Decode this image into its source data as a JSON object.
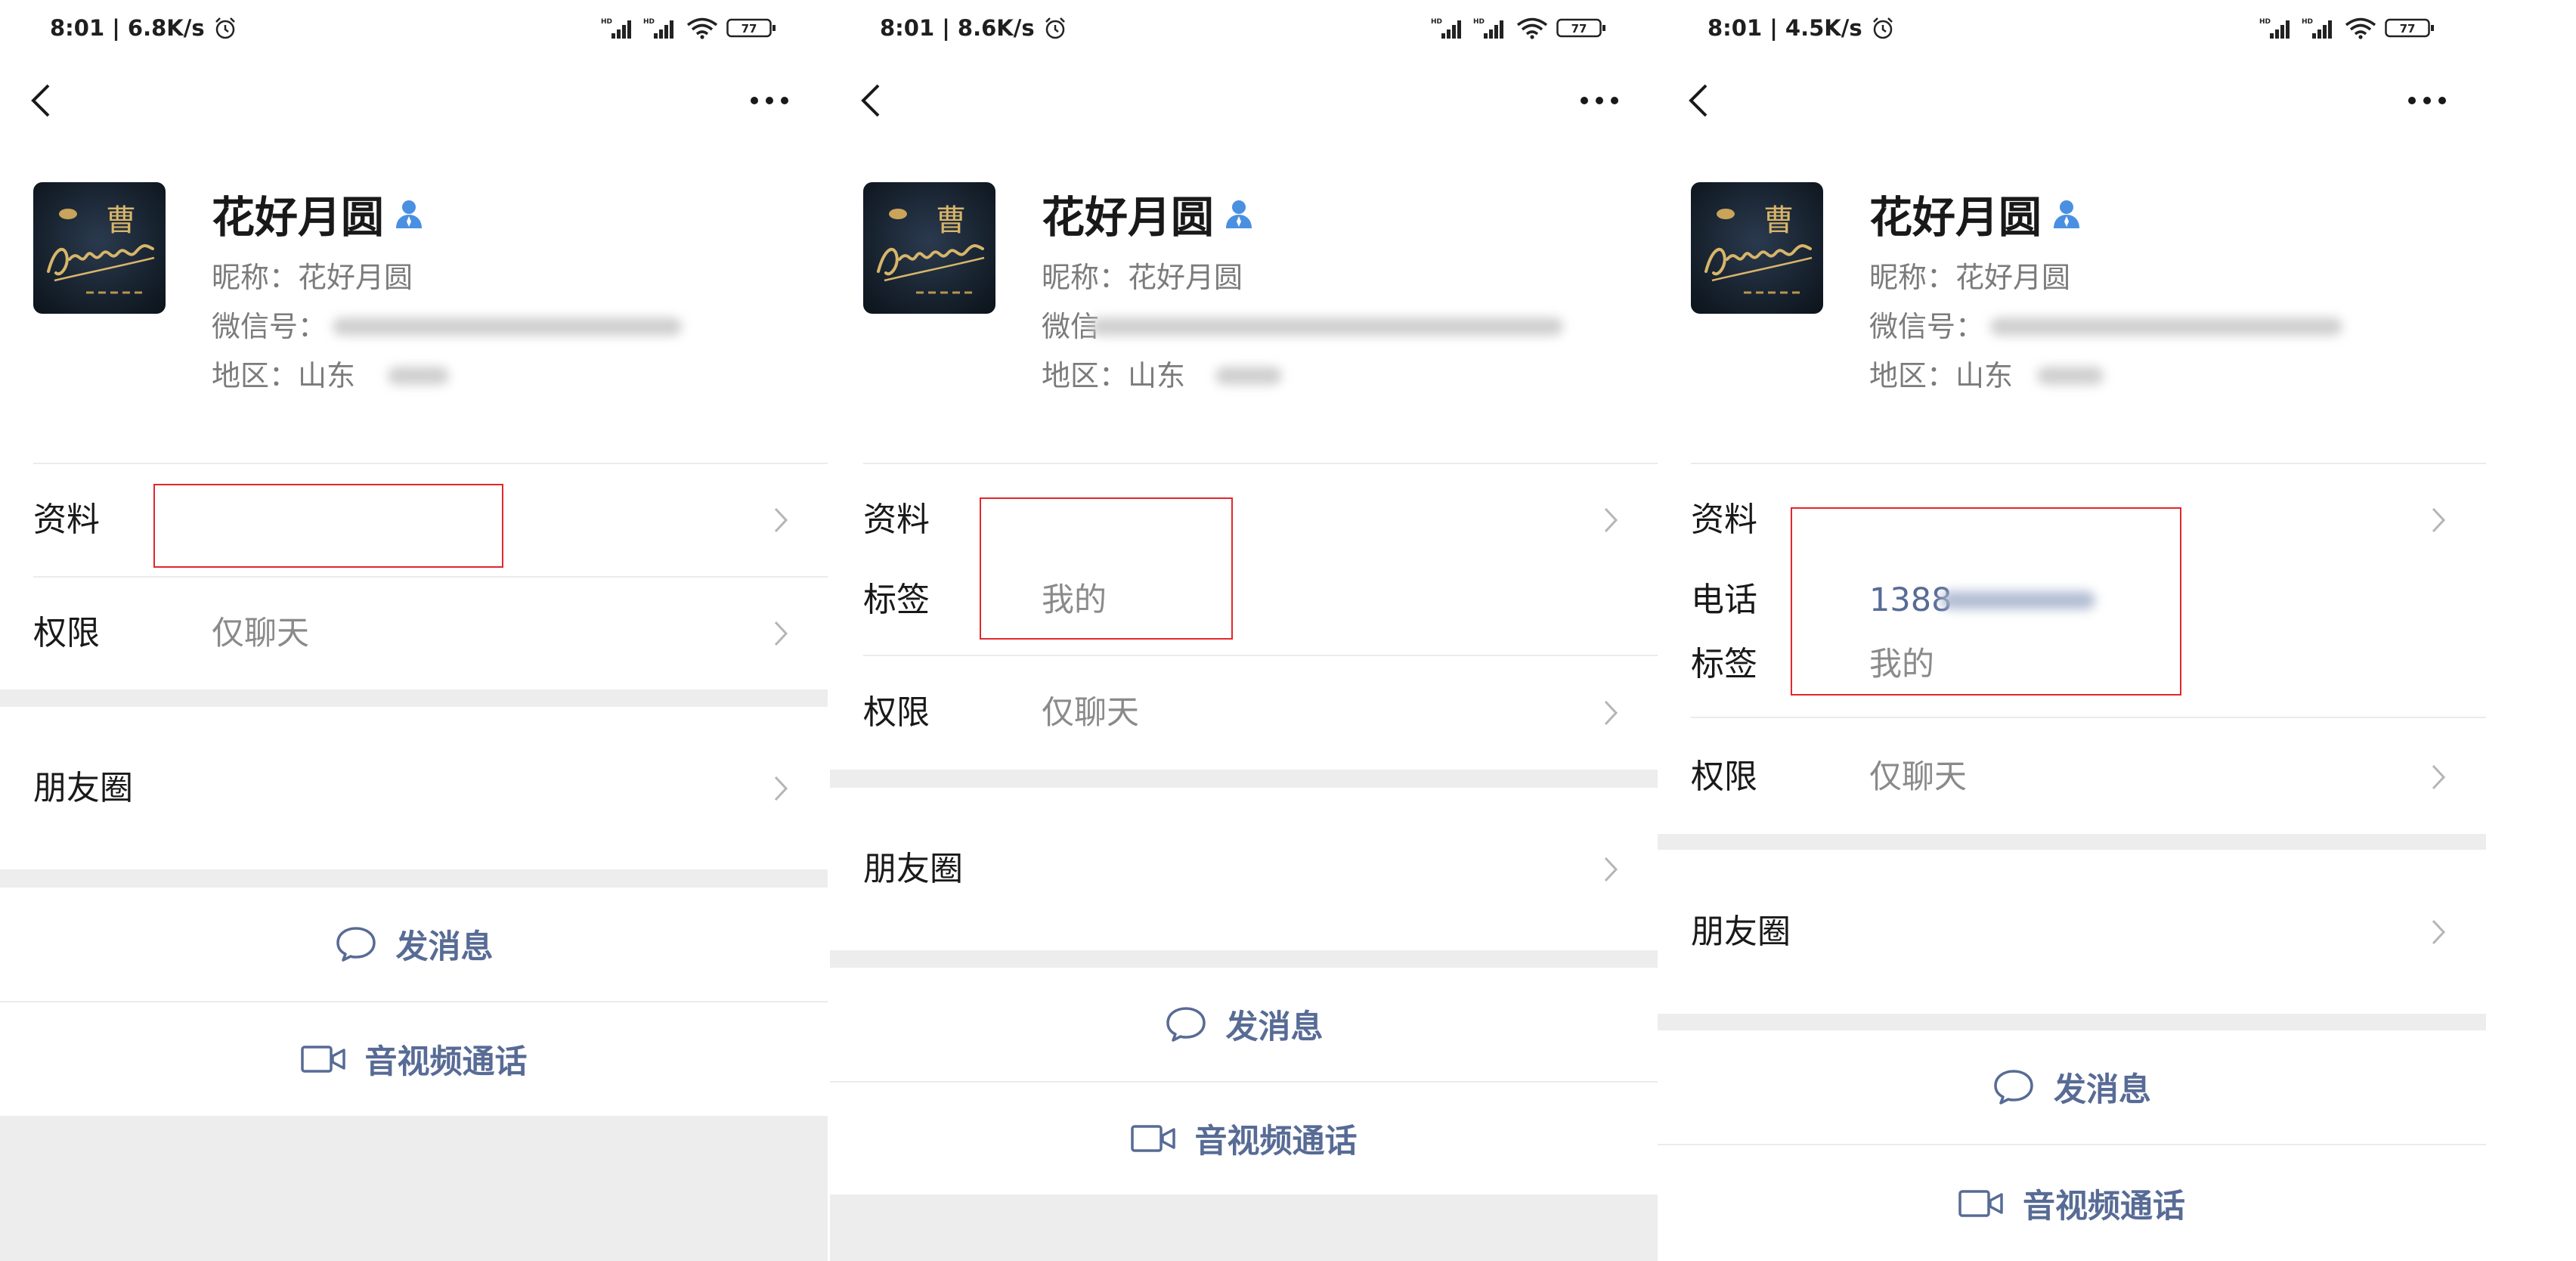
{
  "icons": {
    "back": "back-icon",
    "more": "more-icon",
    "chevron": "chevron-right-icon",
    "verified": "verified-user-icon",
    "message": "chat-bubble-icon",
    "call": "video-call-icon",
    "alarm": "alarm-icon",
    "signal": "signal-icon",
    "wifi": "wifi-icon",
    "battery": "battery-icon"
  },
  "colors": {
    "accent": "#576b95",
    "highlight_box": "#e3262b",
    "verified_badge": "#4a90e2",
    "separator": "#ededed"
  },
  "avatar": {
    "logo_text": "曹"
  },
  "panels": [
    {
      "status": {
        "time": "8:01 | 6.8K/s",
        "signal_label": "HD",
        "battery": "77"
      },
      "profile": {
        "name": "花好月圆",
        "nickname": "昵称：花好月圆",
        "wechat_label": "微信号：",
        "region": "地区：山东"
      },
      "info_rows": [
        {
          "label": "资料"
        }
      ],
      "permission": {
        "label": "权限",
        "value": "仅聊天"
      },
      "moments": {
        "label": "朋友圈"
      },
      "actions": {
        "message": "发消息",
        "call": "音视频通话"
      }
    },
    {
      "status": {
        "time": "8:01 | 8.6K/s",
        "signal_label": "HD",
        "battery": "77"
      },
      "profile": {
        "name": "花好月圆",
        "nickname": "昵称：花好月圆",
        "wechat_label": "微信",
        "region": "地区：山东"
      },
      "info_rows": [
        {
          "label": "资料"
        },
        {
          "label": "标签",
          "value": "我的"
        }
      ],
      "permission": {
        "label": "权限",
        "value": "仅聊天"
      },
      "moments": {
        "label": "朋友圈"
      },
      "actions": {
        "message": "发消息",
        "call": "音视频通话"
      }
    },
    {
      "status": {
        "time": "8:01 | 4.5K/s",
        "signal_label": "HD",
        "battery": "77"
      },
      "profile": {
        "name": "花好月圆",
        "nickname": "昵称：花好月圆",
        "wechat_label": "微信号：",
        "region": "地区：山东"
      },
      "info_rows": [
        {
          "label": "资料"
        },
        {
          "label": "电话",
          "value": "1388"
        },
        {
          "label": "标签",
          "value": "我的"
        }
      ],
      "permission": {
        "label": "权限",
        "value": "仅聊天"
      },
      "moments": {
        "label": "朋友圈"
      },
      "actions": {
        "message": "发消息",
        "call": "音视频通话"
      }
    }
  ]
}
